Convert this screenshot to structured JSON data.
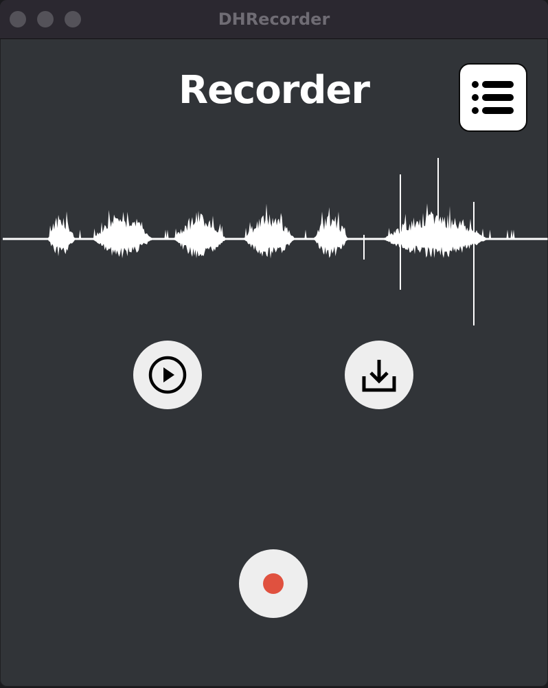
{
  "window": {
    "title": "DHRecorder",
    "controls": [
      "close",
      "minimize",
      "maximize"
    ]
  },
  "main": {
    "heading": "Recorder"
  },
  "toolbar": {
    "list_icon": "list-bullet-icon"
  },
  "controls": {
    "play_icon": "play-circle-icon",
    "download_icon": "download-icon",
    "record_icon": "record-dot-icon"
  },
  "colors": {
    "background": "#313438",
    "titlebar": "#2b2830",
    "waveform": "#ffffff",
    "button_bg": "#eeeeee",
    "record_dot": "#e0513f",
    "title_text": "#6f6c74"
  }
}
